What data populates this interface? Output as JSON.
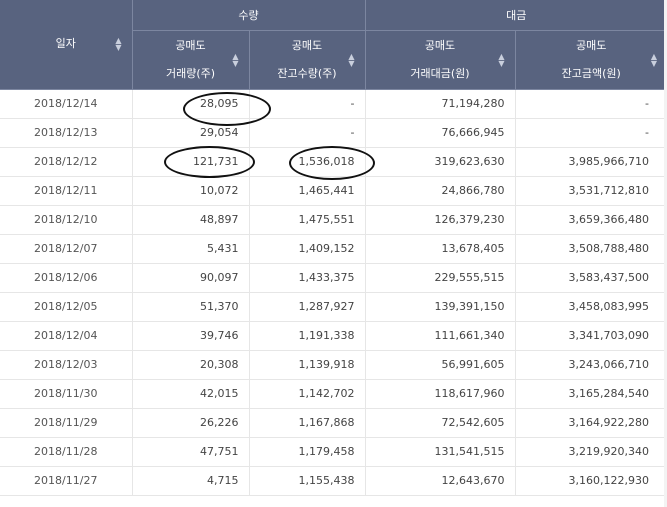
{
  "header": {
    "date_col": "일자",
    "group_quantity": "수량",
    "group_amount": "대금",
    "cols": [
      {
        "line1": "공매도",
        "line2": "거래량(주)"
      },
      {
        "line1": "공매도",
        "line2": "잔고수량(주)"
      },
      {
        "line1": "공매도",
        "line2": "거래대금(원)"
      },
      {
        "line1": "공매도",
        "line2": "잔고금액(원)"
      }
    ]
  },
  "rows": [
    {
      "date": "2018/12/14",
      "vol": "28,095",
      "bal_qty": "-",
      "amt": "71,194,280",
      "bal_amt": "-"
    },
    {
      "date": "2018/12/13",
      "vol": "29,054",
      "bal_qty": "-",
      "amt": "76,666,945",
      "bal_amt": "-"
    },
    {
      "date": "2018/12/12",
      "vol": "121,731",
      "bal_qty": "1,536,018",
      "amt": "319,623,630",
      "bal_amt": "3,985,966,710"
    },
    {
      "date": "2018/12/11",
      "vol": "10,072",
      "bal_qty": "1,465,441",
      "amt": "24,866,780",
      "bal_amt": "3,531,712,810"
    },
    {
      "date": "2018/12/10",
      "vol": "48,897",
      "bal_qty": "1,475,551",
      "amt": "126,379,230",
      "bal_amt": "3,659,366,480"
    },
    {
      "date": "2018/12/07",
      "vol": "5,431",
      "bal_qty": "1,409,152",
      "amt": "13,678,405",
      "bal_amt": "3,508,788,480"
    },
    {
      "date": "2018/12/06",
      "vol": "90,097",
      "bal_qty": "1,433,375",
      "amt": "229,555,515",
      "bal_amt": "3,583,437,500"
    },
    {
      "date": "2018/12/05",
      "vol": "51,370",
      "bal_qty": "1,287,927",
      "amt": "139,391,150",
      "bal_amt": "3,458,083,995"
    },
    {
      "date": "2018/12/04",
      "vol": "39,746",
      "bal_qty": "1,191,338",
      "amt": "111,661,340",
      "bal_amt": "3,341,703,090"
    },
    {
      "date": "2018/12/03",
      "vol": "20,308",
      "bal_qty": "1,139,918",
      "amt": "56,991,605",
      "bal_amt": "3,243,066,710"
    },
    {
      "date": "2018/11/30",
      "vol": "42,015",
      "bal_qty": "1,142,702",
      "amt": "118,617,960",
      "bal_amt": "3,165,284,540"
    },
    {
      "date": "2018/11/29",
      "vol": "26,226",
      "bal_qty": "1,167,868",
      "amt": "72,542,605",
      "bal_amt": "3,164,922,280"
    },
    {
      "date": "2018/11/28",
      "vol": "47,751",
      "bal_qty": "1,179,458",
      "amt": "131,541,515",
      "bal_amt": "3,219,920,340"
    },
    {
      "date": "2018/11/27",
      "vol": "4,715",
      "bal_qty": "1,155,438",
      "amt": "12,643,670",
      "bal_amt": "3,160,122,930"
    }
  ],
  "colors": {
    "header_bg": "#58637f",
    "header_text": "#ffffff",
    "annotation": "#111111"
  }
}
